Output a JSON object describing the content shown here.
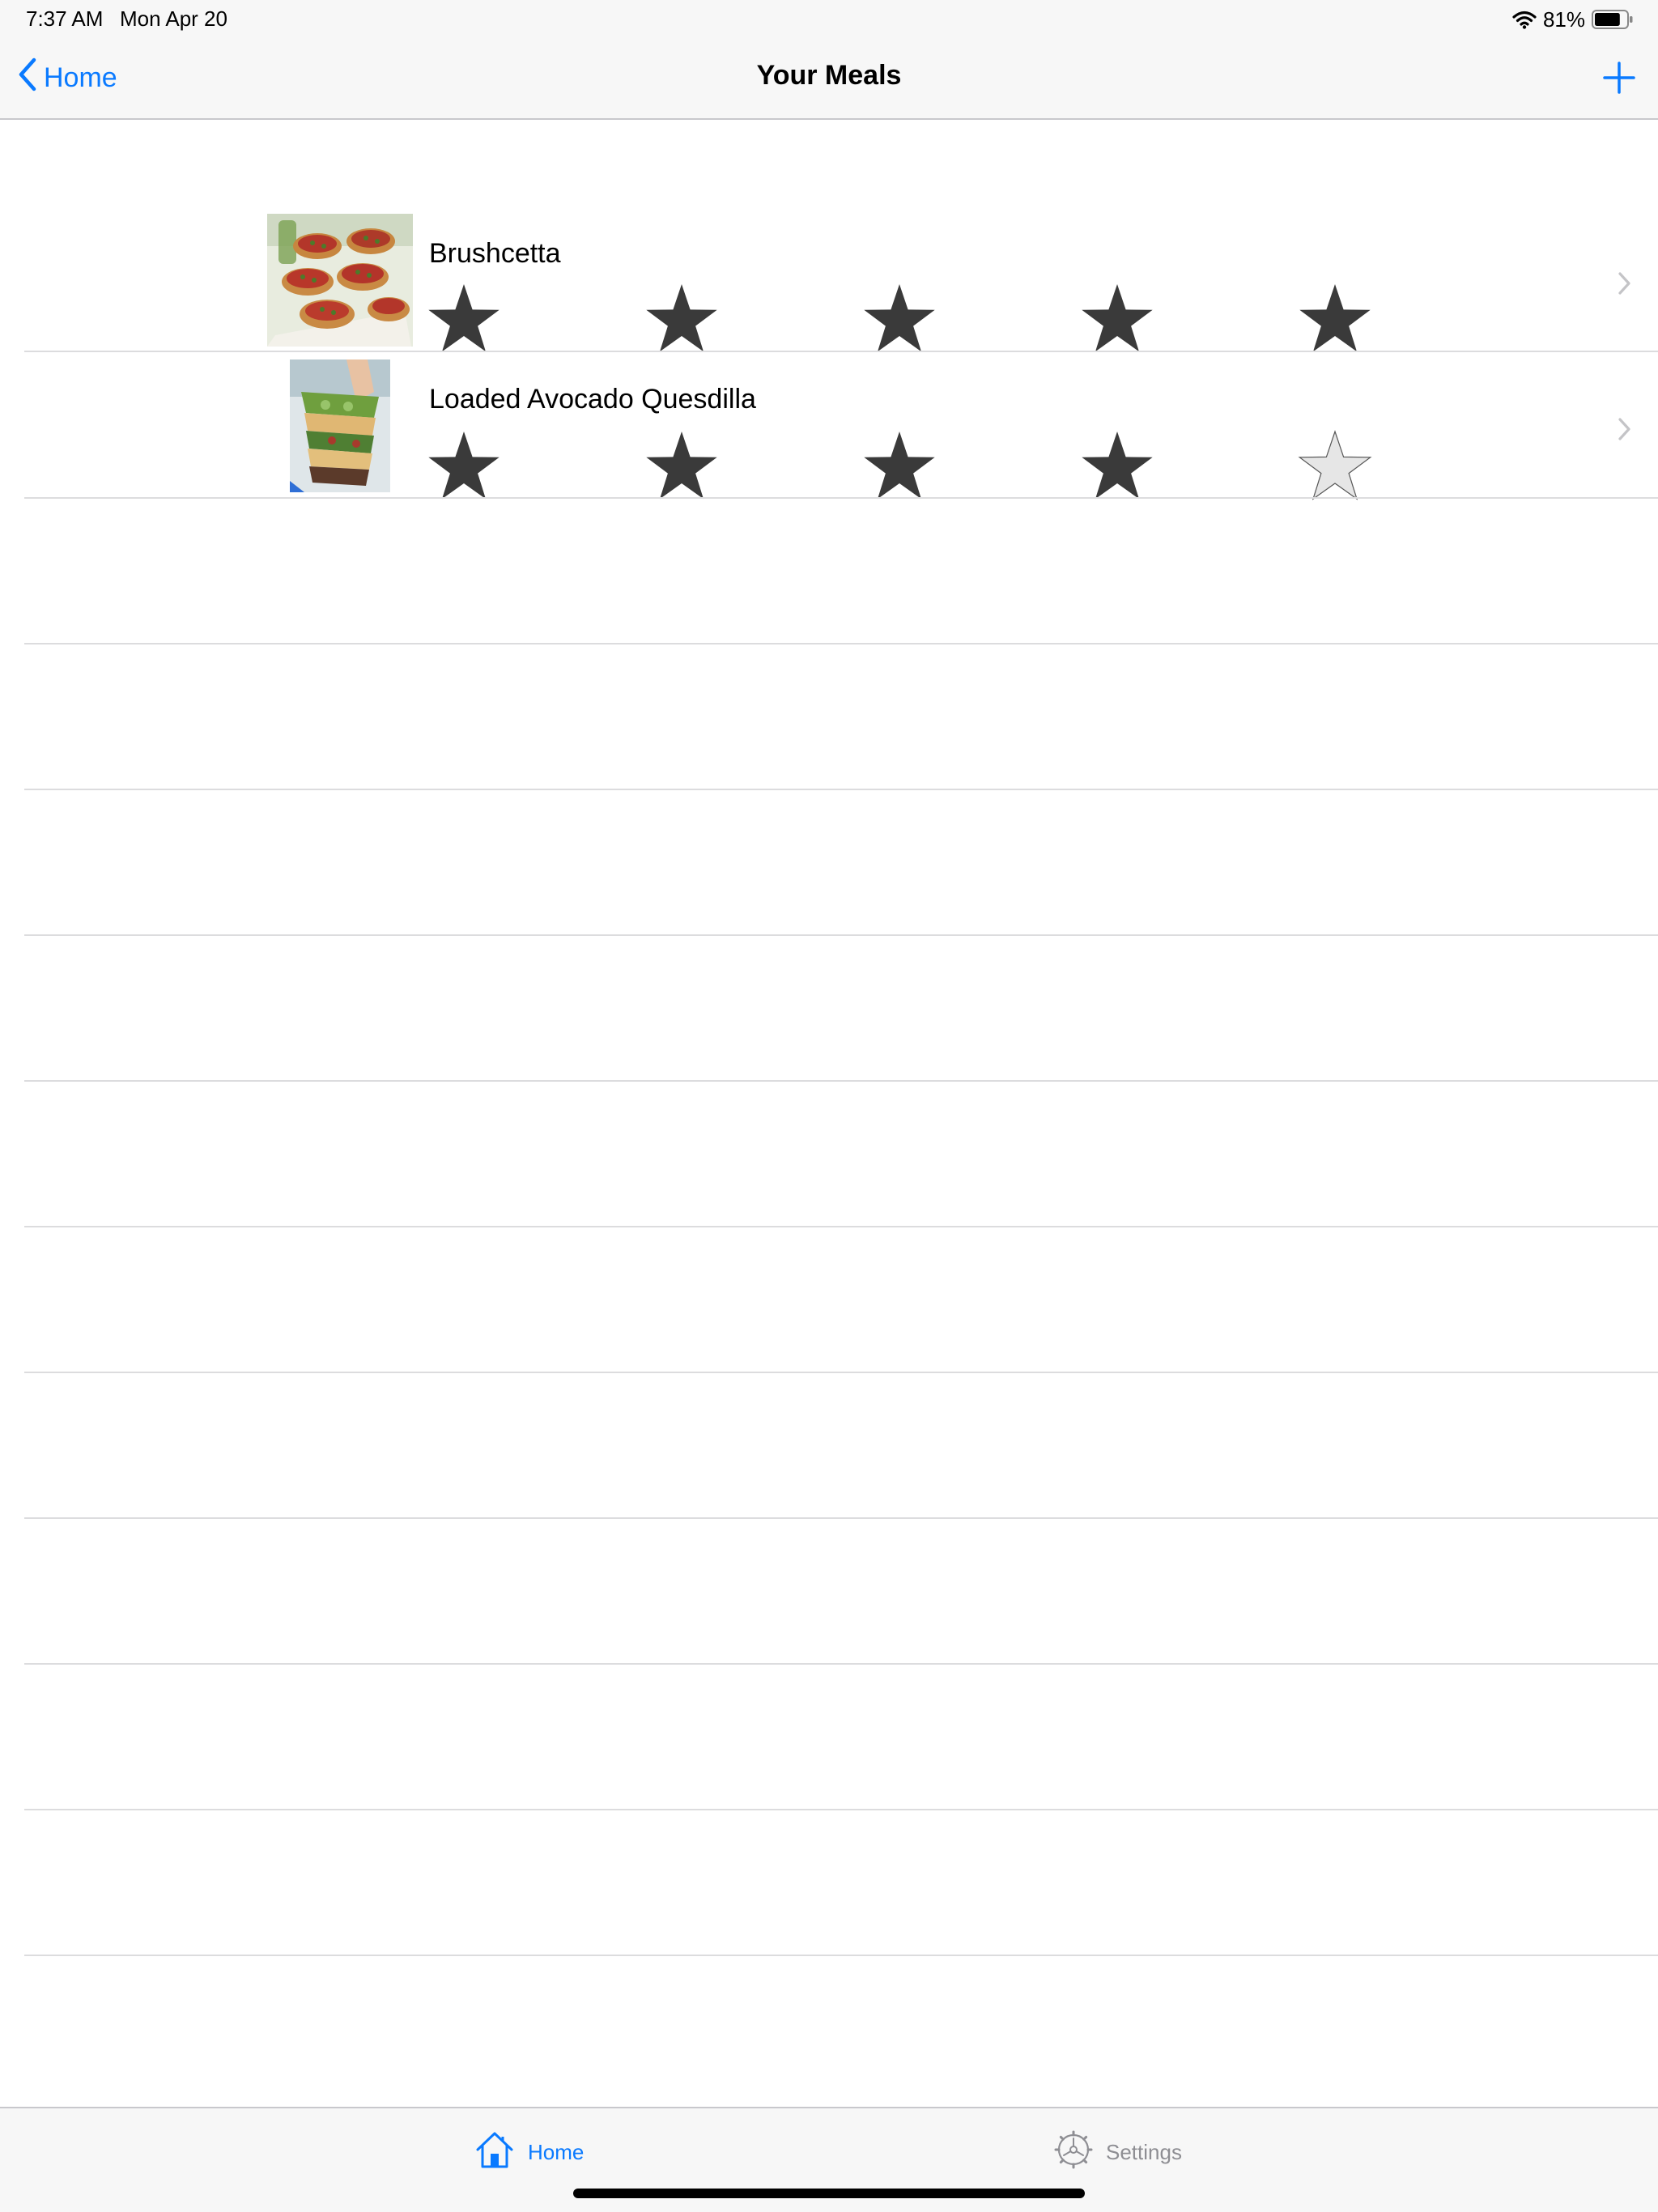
{
  "status_bar": {
    "time": "7:37 AM",
    "date": "Mon Apr 20",
    "battery": "81%",
    "battery_level": 0.81
  },
  "nav": {
    "back_label": "Home",
    "title": "Your Meals"
  },
  "meals": [
    {
      "name": "Brushcetta",
      "rating": 5,
      "max_rating": 5
    },
    {
      "name": "Loaded Avocado Quesdilla",
      "rating": 4,
      "max_rating": 5
    }
  ],
  "tab_bar": {
    "home_label": "Home",
    "settings_label": "Settings"
  },
  "colors": {
    "accent": "#0a7aff",
    "star_filled": "#3a3a3a",
    "star_empty": "#e6e6e6",
    "separator": "#dcdcde",
    "bar_background": "#f7f7f7"
  }
}
